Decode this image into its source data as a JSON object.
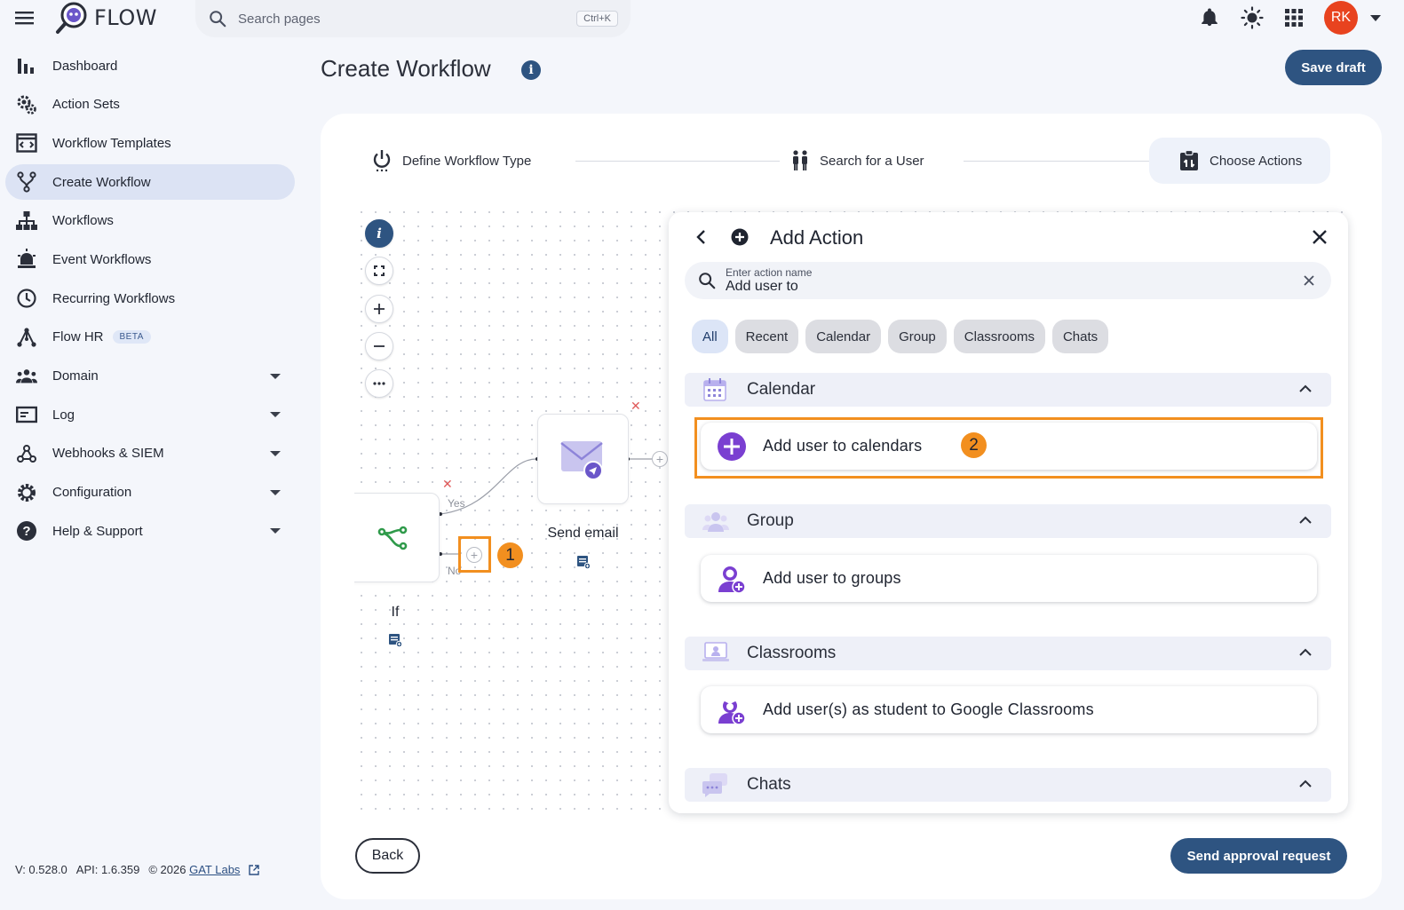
{
  "app": {
    "name": "FLOW"
  },
  "search": {
    "placeholder": "Search pages",
    "shortcut": "Ctrl+K"
  },
  "user": {
    "initials": "RK",
    "avatar_color": "#e8431f"
  },
  "sidebar": {
    "items": [
      {
        "label": "Dashboard",
        "icon": "bar-chart-icon"
      },
      {
        "label": "Action Sets",
        "icon": "gears-icon"
      },
      {
        "label": "Workflow Templates",
        "icon": "template-icon"
      },
      {
        "label": "Create Workflow",
        "icon": "branch-icon",
        "active": true
      },
      {
        "label": "Workflows",
        "icon": "hierarchy-icon"
      },
      {
        "label": "Event Workflows",
        "icon": "alarm-icon"
      },
      {
        "label": "Recurring Workflows",
        "icon": "clock-icon"
      },
      {
        "label": "Flow HR",
        "icon": "network-icon",
        "badge": "BETA"
      },
      {
        "label": "Domain",
        "icon": "people-icon",
        "expandable": true
      },
      {
        "label": "Log",
        "icon": "log-icon",
        "expandable": true
      },
      {
        "label": "Webhooks & SIEM",
        "icon": "webhook-icon",
        "expandable": true
      },
      {
        "label": "Configuration",
        "icon": "gear-icon",
        "expandable": true
      },
      {
        "label": "Help & Support",
        "icon": "help-icon",
        "expandable": true
      }
    ]
  },
  "footer": {
    "version": "V: 0.528.0",
    "api": "API: 1.6.359",
    "copyright": "© 2026",
    "company_link": "GAT Labs"
  },
  "page": {
    "title": "Create Workflow",
    "save_label": "Save draft"
  },
  "steps": [
    {
      "label": "Define Workflow Type",
      "icon": "power-icon"
    },
    {
      "label": "Search for a User",
      "icon": "users-icon"
    },
    {
      "label": "Choose Actions",
      "icon": "clipboard-icon",
      "active": true
    }
  ],
  "canvas": {
    "nodes": [
      {
        "label": "If",
        "icon": "branch-icon"
      },
      {
        "label": "Send email",
        "icon": "email-icon"
      }
    ],
    "edges": {
      "yes": "Yes",
      "no": "No"
    },
    "badges": [
      "1",
      "2"
    ]
  },
  "panel": {
    "title": "Add Action",
    "search_label": "Enter action name",
    "search_value": "Add user to",
    "filters": [
      "All",
      "Recent",
      "Calendar",
      "Group",
      "Classrooms",
      "Chats"
    ],
    "active_filter": "All",
    "sections": [
      {
        "title": "Calendar",
        "actions": [
          "Add user to calendars"
        ]
      },
      {
        "title": "Group",
        "actions": [
          "Add user to groups"
        ]
      },
      {
        "title": "Classrooms",
        "actions": [
          "Add user(s) as student to Google Classrooms"
        ]
      },
      {
        "title": "Chats",
        "actions": []
      }
    ]
  },
  "buttons": {
    "back": "Back",
    "send_approval": "Send approval request"
  },
  "colors": {
    "primary": "#2e5481",
    "highlight": "#f28f1f",
    "accent_purple": "#7a3fd1"
  }
}
